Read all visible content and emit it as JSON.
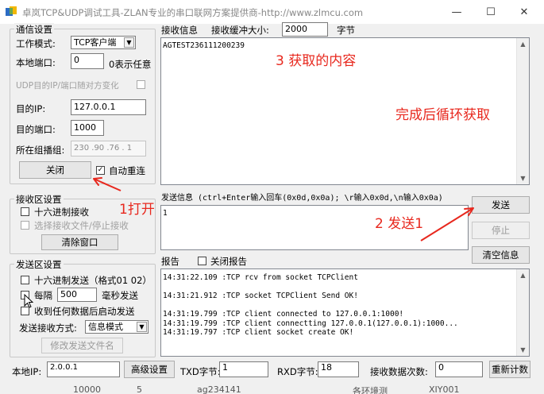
{
  "window": {
    "title": "卓岚TCP&UDP调试工具-ZLAN专业的串口联网方案提供商-http://www.zlmcu.com",
    "min_glyph": "—",
    "max_glyph": "☐",
    "close_glyph": "✕"
  },
  "comm": {
    "group_label": "通信设置",
    "mode_label": "工作模式:",
    "mode_value": "TCP客户端",
    "local_port_label": "本地端口:",
    "local_port_value": "0",
    "local_port_hint": "0表示任意",
    "udp_target_label": "UDP目的IP/端口随对方变化",
    "target_ip_label": "目的IP:",
    "target_ip_value": "127.0.0.1",
    "target_port_label": "目的端口:",
    "target_port_value": "1000",
    "group_ip_label": "所在组播组:",
    "group_ip_value": "230 .90 .76 . 1",
    "close_button": "关闭",
    "auto_reconnect_label": "自动重连",
    "auto_reconnect_checked": true
  },
  "recv_settings": {
    "group_label": "接收区设置",
    "hex_label": "十六进制接收",
    "select_file_label": "选择接收文件/停止接收",
    "clear_button": "清除窗口"
  },
  "send_settings": {
    "group_label": "发送区设置",
    "hex_label": "十六进制发送（格式01 02）",
    "interval_prefix": "每隔",
    "interval_value": "500",
    "interval_suffix": "毫秒发送",
    "send_after_recv_label": "收到任何数据后启动发送",
    "mode_label": "发送接收方式:",
    "mode_value": "信息模式",
    "modify_file_button": "修改发送文件名"
  },
  "recv_info": {
    "label": "接收信息",
    "buffer_label": "接收缓冲大小:",
    "buffer_value": "2000",
    "buffer_unit": "字节",
    "content": "AGTEST236111200239"
  },
  "send_info": {
    "label": "发送信息 (ctrl+Enter输入回车(0x0d,0x0a); \\r输入0x0d,\\n输入0x0a)",
    "content": "1",
    "send_button": "发送",
    "stop_button": "停止",
    "clear_info_button": "清空信息"
  },
  "report": {
    "label": "报告",
    "close_report_label": "关闭报告",
    "lines": [
      "14:31:22.109 :TCP rcv from socket TCPClient",
      "",
      "14:31:21.912 :TCP socket TCPClient Send OK!",
      "",
      "14:31:19.799 :TCP client connected to 127.0.0.1:1000!",
      "14:31:19.799 :TCP client connectting 127.0.0.1(127.0.0.1):1000...",
      "14:31:19.797 :TCP client socket create OK!"
    ]
  },
  "statusbar": {
    "local_ip_label": "本地IP:",
    "local_ip_value": "2.0.0.1",
    "advanced_button": "高级设置",
    "txd_label": "TXD字节:",
    "txd_value": "1",
    "rxd_label": "RXD字节:",
    "rxd_value": "18",
    "recv_count_label": "接收数据次数:",
    "recv_count_value": "0",
    "recount_button": "重新计数"
  },
  "annotations": {
    "content_note": "3 获取的内容",
    "loop_note": "完成后循环获取",
    "open_note": "1打开",
    "send_note": "2 发送1",
    "color": "#e8281e"
  },
  "background_row": [
    "10000",
    "5",
    "ag234141",
    "各环境测",
    "XIY001"
  ]
}
